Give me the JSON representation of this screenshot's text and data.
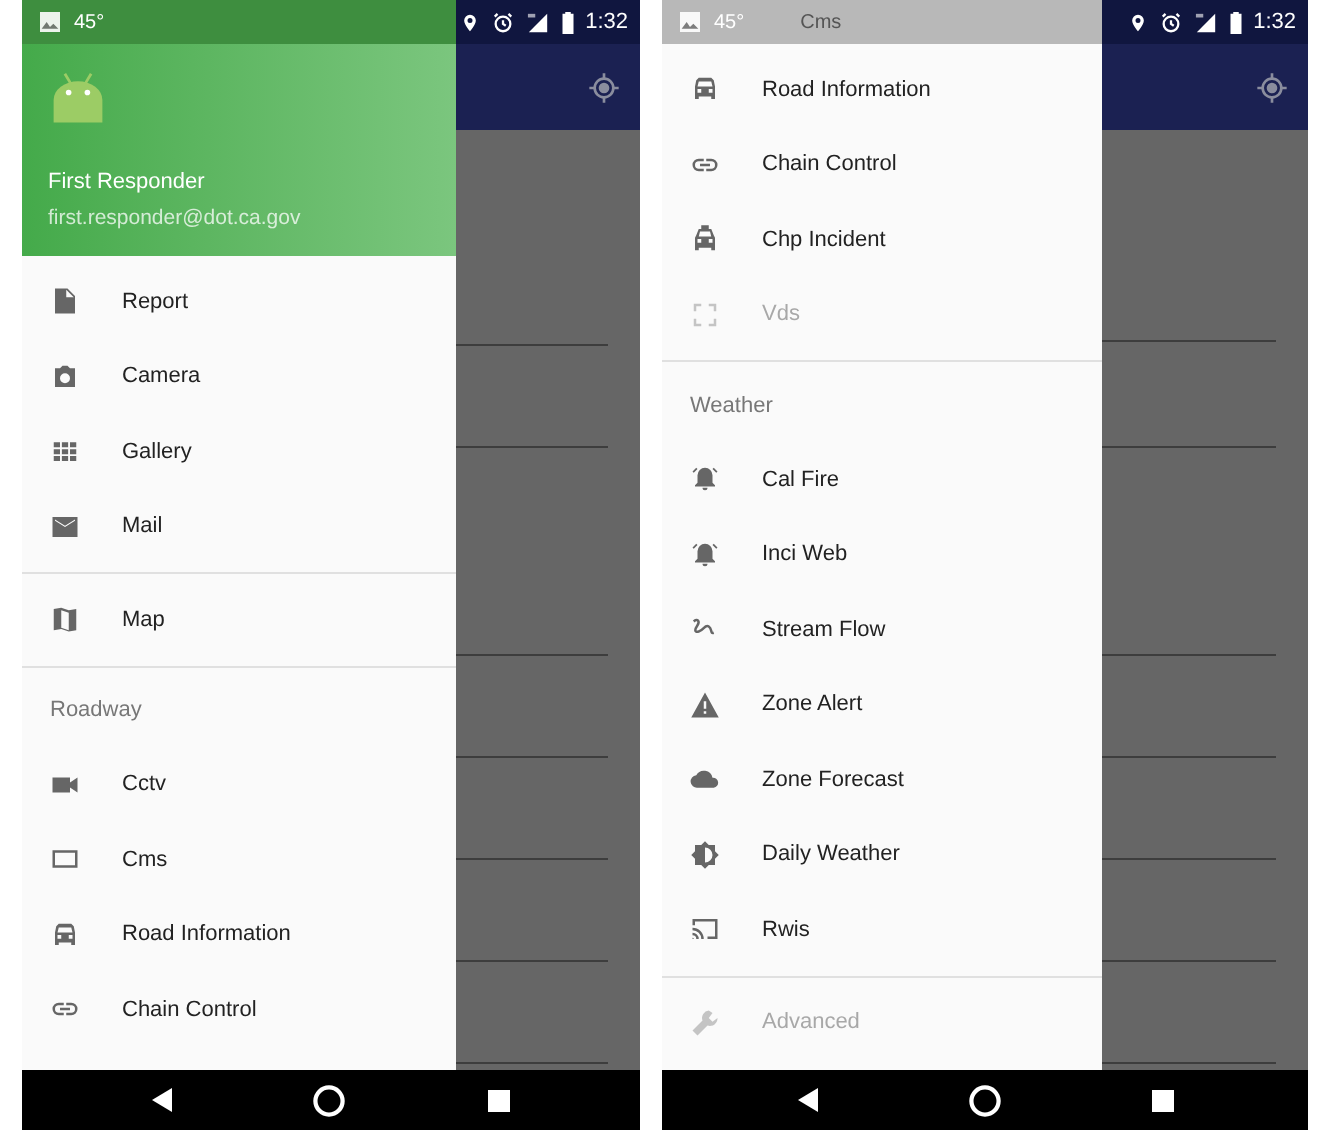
{
  "screens": [
    {
      "status_bar": {
        "temperature": "45°",
        "time": "1:32"
      },
      "header": {
        "name": "First Responder",
        "email": "first.responder@dot.ca.gov"
      },
      "sections": [
        {
          "items": [
            {
              "label": "Report",
              "disabled": false
            },
            {
              "label": "Camera",
              "disabled": false
            },
            {
              "label": "Gallery",
              "disabled": false
            },
            {
              "label": "Mail",
              "disabled": false
            }
          ]
        },
        {
          "items": [
            {
              "label": "Map",
              "disabled": false
            }
          ]
        },
        {
          "title": "Roadway",
          "items": [
            {
              "label": "Cctv",
              "disabled": false
            },
            {
              "label": "Cms",
              "disabled": false
            },
            {
              "label": "Road Information",
              "disabled": false
            },
            {
              "label": "Chain Control",
              "disabled": false
            }
          ]
        }
      ]
    },
    {
      "status_bar": {
        "temperature": "45°",
        "time": "1:32"
      },
      "cut_item": "Cms",
      "sections": [
        {
          "items": [
            {
              "label": "Road Information",
              "disabled": false
            },
            {
              "label": "Chain Control",
              "disabled": false
            },
            {
              "label": "Chp Incident",
              "disabled": false
            },
            {
              "label": "Vds",
              "disabled": true
            }
          ]
        },
        {
          "title": "Weather",
          "items": [
            {
              "label": "Cal Fire",
              "disabled": false
            },
            {
              "label": "Inci Web",
              "disabled": false
            },
            {
              "label": "Stream Flow",
              "disabled": false
            },
            {
              "label": "Zone Alert",
              "disabled": false
            },
            {
              "label": "Zone Forecast",
              "disabled": false
            },
            {
              "label": "Daily Weather",
              "disabled": false
            },
            {
              "label": "Rwis",
              "disabled": false
            }
          ]
        },
        {
          "items": [
            {
              "label": "Advanced",
              "disabled": true
            }
          ]
        }
      ]
    }
  ]
}
